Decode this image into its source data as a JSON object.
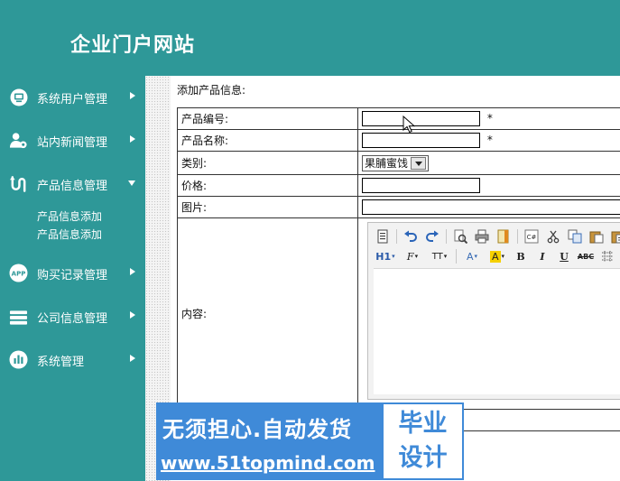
{
  "header": {
    "title": "企业门户网站"
  },
  "sidebar": {
    "items": [
      {
        "label": "系统用户管理",
        "icon": "monitor-icon"
      },
      {
        "label": "站内新闻管理",
        "icon": "user-gear-icon"
      },
      {
        "label": "产品信息管理",
        "icon": "route-icon",
        "expanded": true,
        "sub_items": [
          "产品信息添加",
          "产品信息添加"
        ]
      },
      {
        "label": "购买记录管理",
        "icon": "app-icon"
      },
      {
        "label": "公司信息管理",
        "icon": "stack-icon"
      },
      {
        "label": "系统管理",
        "icon": "bar-chart-icon"
      }
    ]
  },
  "main": {
    "panel_title": "添加产品信息:",
    "form": {
      "code_label": "产品编号:",
      "code_value": "",
      "name_label": "产品名称:",
      "name_value": "",
      "required_mark": "*",
      "category_label": "类别:",
      "category_value": "果脯蜜饯",
      "price_label": "价格:",
      "price_value": "",
      "image_label": "图片:",
      "image_value": "",
      "content_label": "内容:"
    },
    "editor": {
      "toolbar_row1": [
        "source-icon",
        "undo-icon",
        "redo-icon",
        "preview-icon",
        "print-icon",
        "template-icon",
        "code-icon",
        "cut-icon",
        "copy-icon",
        "paste-icon",
        "paste-text-icon"
      ],
      "toolbar_row2": {
        "heading": "H1",
        "font_family": "F",
        "font_size": "TT",
        "font_color": "A",
        "bg_color": "A",
        "bold": "B",
        "italic": "I",
        "underline": "U",
        "strike": "ABC"
      }
    }
  },
  "banner": {
    "main_text": "无须担心.自动发货",
    "url_text": "www.51topmind.com",
    "badge_line1": "毕业",
    "badge_line2": "设计"
  },
  "colors": {
    "sidebar": "#2e9898",
    "banner": "#3f8ad8"
  }
}
